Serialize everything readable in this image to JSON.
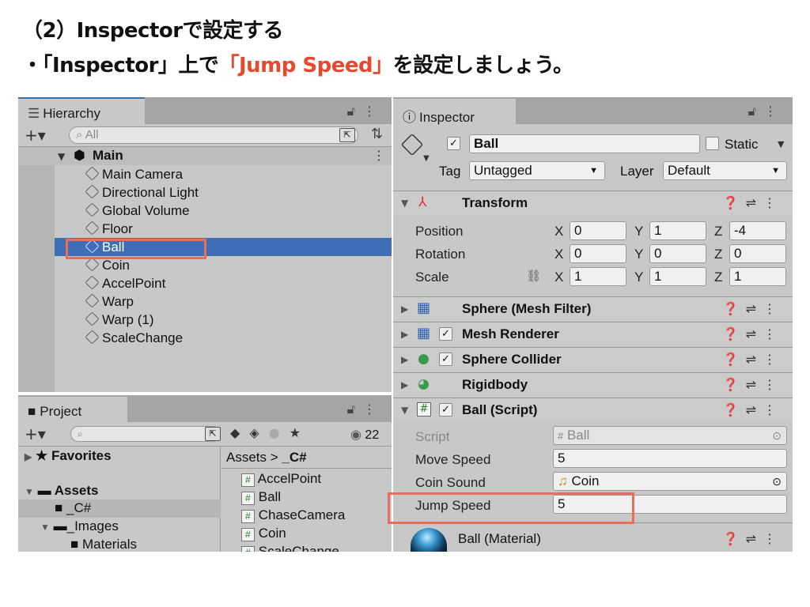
{
  "heading": {
    "line1": "（2）Inspectorで設定する",
    "line2_a": "・「Inspector」上で",
    "line2_b": "「Jump Speed」",
    "line2_c": "を設定しましょう。"
  },
  "hierarchy": {
    "tab": "Hierarchy",
    "search_placeholder": "All",
    "scene": "Main",
    "items": [
      "Main Camera",
      "Directional Light",
      "Global Volume",
      "Floor",
      "Ball",
      "Coin",
      "AccelPoint",
      "Warp",
      "Warp (1)",
      "ScaleChange"
    ],
    "selected": "Ball"
  },
  "project": {
    "tab": "Project",
    "hidden_count": "22",
    "tree": {
      "favorites": "Favorites",
      "assets": "Assets",
      "c_folder": "_C#",
      "images": "_Images",
      "materials": "Materials"
    },
    "breadcrumb": {
      "root": "Assets",
      "sep": ">",
      "current": "_C#"
    },
    "files": [
      "AccelPoint",
      "Ball",
      "ChaseCamera",
      "Coin",
      "ScaleChange"
    ]
  },
  "inspector": {
    "tab": "Inspector",
    "object_name": "Ball",
    "static_label": "Static",
    "tag_label": "Tag",
    "tag_value": "Untagged",
    "layer_label": "Layer",
    "layer_value": "Default",
    "transform": {
      "title": "Transform",
      "position_label": "Position",
      "rotation_label": "Rotation",
      "scale_label": "Scale",
      "position": {
        "x": "0",
        "y": "1",
        "z": "-4"
      },
      "rotation": {
        "x": "0",
        "y": "0",
        "z": "0"
      },
      "scale": {
        "x": "1",
        "y": "1",
        "z": "1"
      }
    },
    "components": [
      "Sphere (Mesh Filter)",
      "Mesh Renderer",
      "Sphere Collider",
      "Rigidbody",
      "Ball (Script)"
    ],
    "script": {
      "script_label": "Script",
      "script_value": "Ball",
      "move_speed_label": "Move Speed",
      "move_speed": "5",
      "coin_sound_label": "Coin Sound",
      "coin_sound": "Coin",
      "jump_speed_label": "Jump Speed",
      "jump_speed": "5"
    },
    "material": "Ball (Material)"
  },
  "colors": {
    "accent_red": "#e6492d",
    "selection_blue": "#3e6fb6",
    "panel_bg": "#c8c8c8"
  }
}
